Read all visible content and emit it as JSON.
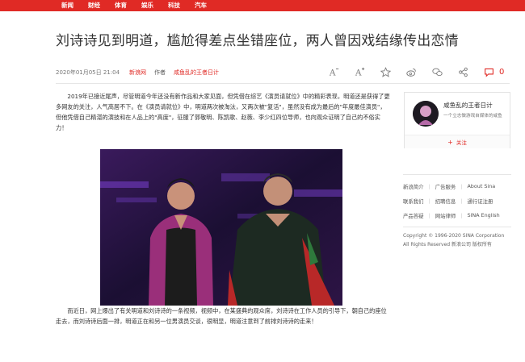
{
  "topnav": {
    "items": [
      "新闻",
      "财经",
      "体育",
      "娱乐",
      "科技",
      "汽车"
    ],
    "bg_color": "#e02a25"
  },
  "article": {
    "title": "刘诗诗见到明道，尴尬得差点坐错座位，两人曾因戏结缘传出恋情",
    "date": "2020年01月05日 21:04",
    "source": "新浪网",
    "author_label": "作者",
    "author": "咸鱼乱的王者日计",
    "paragraph1": "2019年已接近尾声，尽管明道今年还没有新作品和大家见面，但凭借在综艺《演员请就位》中的精彩表现，明道还是获得了更多网友的关注，人气高居不下。在《演员请就位》中，明道两次被淘汰，又两次被\"复活\"，虽然没有成为最后的\"年度最佳演员\"，但他凭借自己精湛的演技和在人品上的\"高度\"，征服了郭敬明、陈凯歌、赵薇、李少红四位导师，也向观众证明了自己的不俗实力！",
    "paragraph2": "而近日，网上爆出了有关明道和刘诗诗的一条视频，视频中，在某盛典的观众席，刘诗诗在工作人员的引导下，朝自己的座位走去，而刘诗诗后面一排，明道正在和另一位男演员交谈，很明显，明道注意到了前排刘诗诗的走来！",
    "comment_count": "0"
  },
  "toolbar": {
    "icons": [
      "font-decrease-icon",
      "font-increase-icon",
      "favorite-star-icon",
      "weibo-icon",
      "wechat-icon",
      "share-icon",
      "comment-icon"
    ]
  },
  "author_card": {
    "name": "咸鱼乱的王者日计",
    "desc": "一个立志做游戏自媒体的咸鱼",
    "follow_label": "关注"
  },
  "footer": {
    "row1": [
      "新浪简介",
      "广告服务",
      "About Sina"
    ],
    "row2": [
      "联系我们",
      "招聘信息",
      "通行证注册"
    ],
    "row3": [
      "产品答疑",
      "网站律师",
      "SINA English"
    ],
    "copyright1": "Copyright © 1996-2020 SINA Corporation",
    "copyright2": "All Rights Reserved 新浪公司 版权所有"
  },
  "accent_color": "#e02a25"
}
